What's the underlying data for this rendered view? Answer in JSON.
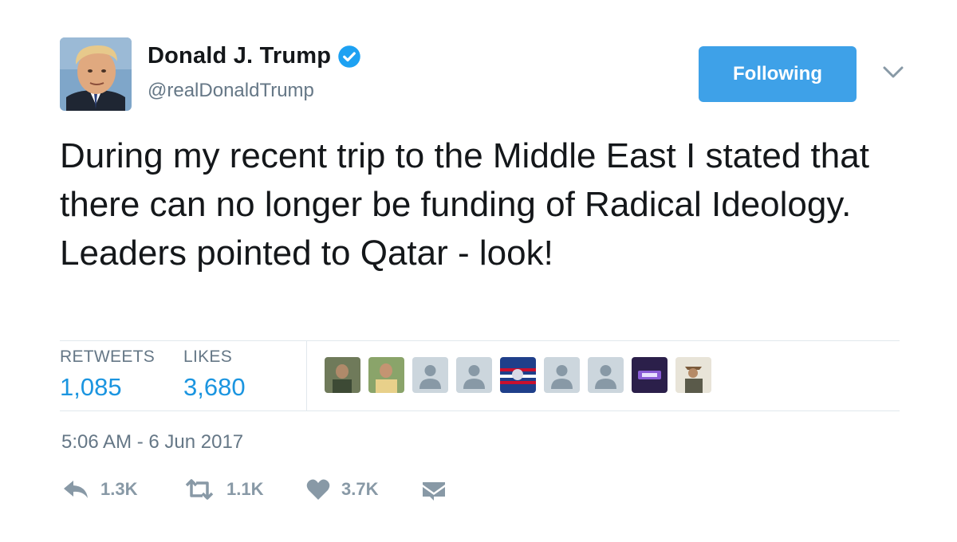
{
  "author": {
    "name": "Donald J. Trump",
    "handle": "@realDonaldTrump",
    "verified_icon": "verified-badge-icon"
  },
  "follow_button": {
    "label": "Following"
  },
  "tweet": {
    "text": "During my recent trip to the Middle East I stated that there can no longer be funding of Radical Ideology. Leaders pointed to Qatar - look!"
  },
  "stats": {
    "retweets_label": "RETWEETS",
    "retweets_value": "1,085",
    "likes_label": "LIKES",
    "likes_value": "3,680"
  },
  "likers": [
    {
      "kind": "photo"
    },
    {
      "kind": "photo"
    },
    {
      "kind": "default"
    },
    {
      "kind": "default"
    },
    {
      "kind": "flag"
    },
    {
      "kind": "default"
    },
    {
      "kind": "default"
    },
    {
      "kind": "logo"
    },
    {
      "kind": "photo"
    }
  ],
  "timestamp": "5:06 AM - 6 Jun 2017",
  "actions": {
    "reply_count": "1.3K",
    "retweet_count": "1.1K",
    "like_count": "3.7K"
  },
  "colors": {
    "accent": "#1b95e0",
    "button": "#3ea1e8",
    "muted": "#657786",
    "divider": "#e1e8ed"
  }
}
